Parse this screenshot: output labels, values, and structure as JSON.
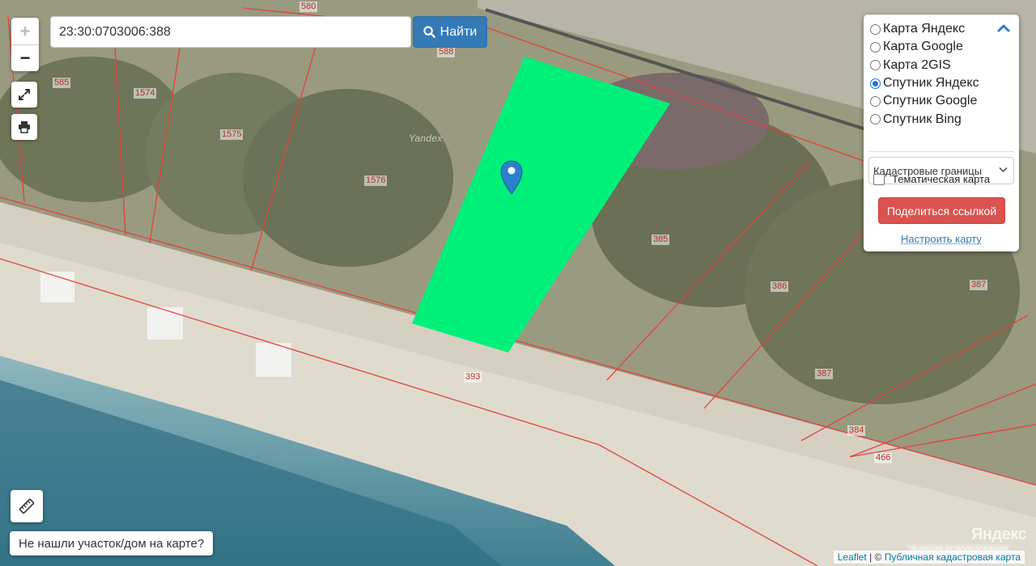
{
  "search": {
    "value": "23:30:0703006:388",
    "button_label": "Найти"
  },
  "zoom": {
    "in_label": "+",
    "out_label": "−"
  },
  "layers": {
    "options": [
      {
        "label": "Карта Яндекс",
        "checked": false
      },
      {
        "label": "Карта Google",
        "checked": false
      },
      {
        "label": "Карта 2GIS",
        "checked": false
      },
      {
        "label": "Спутник Яндекс",
        "checked": true
      },
      {
        "label": "Спутник Google",
        "checked": false
      },
      {
        "label": "Спутник Bing",
        "checked": false
      }
    ],
    "overlay_select": "Кадастровые границы",
    "thematic_label": "Тематическая карта",
    "share_label": "Поделиться ссылкой",
    "config_link": "Настроить карту"
  },
  "map": {
    "parcel_labels": [
      "580",
      "588",
      "585",
      "1574",
      "1575",
      "1576",
      "385",
      "386",
      "387",
      "387",
      "393",
      "384",
      "466"
    ],
    "selected_parcel_color": "#00f07a",
    "boundary_color": "#e0443c",
    "watermark": "Yandex",
    "terms": "Условия использования",
    "yandex_logo": "Яндекс"
  },
  "bottom": {
    "not_found_label": "Не нашли участок/дом на карте?"
  },
  "attribution": {
    "leaflet": "Leaflet",
    "separator": " | © ",
    "source": "Публичная кадастровая карта"
  }
}
